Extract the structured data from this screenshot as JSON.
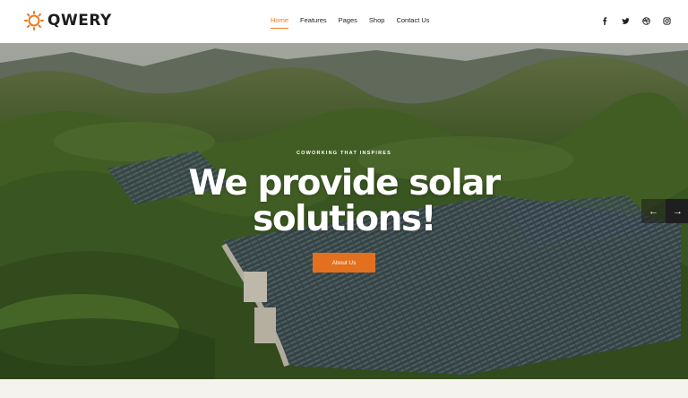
{
  "brand": {
    "name": "QWERY",
    "accent": "#ea7a1f"
  },
  "nav": {
    "items": [
      {
        "label": "Home",
        "active": true
      },
      {
        "label": "Features",
        "active": false
      },
      {
        "label": "Pages",
        "active": false
      },
      {
        "label": "Shop",
        "active": false
      },
      {
        "label": "Contact Us",
        "active": false
      }
    ]
  },
  "social": [
    "facebook-icon",
    "twitter-icon",
    "dribbble-icon",
    "instagram-icon"
  ],
  "hero": {
    "kicker": "COWORKING THAT INSPIRES",
    "headline_line1": "We provide solar",
    "headline_line2": "solutions!",
    "cta_label": "About Us",
    "prev_icon": "arrow-left-icon",
    "next_icon": "arrow-right-icon"
  }
}
